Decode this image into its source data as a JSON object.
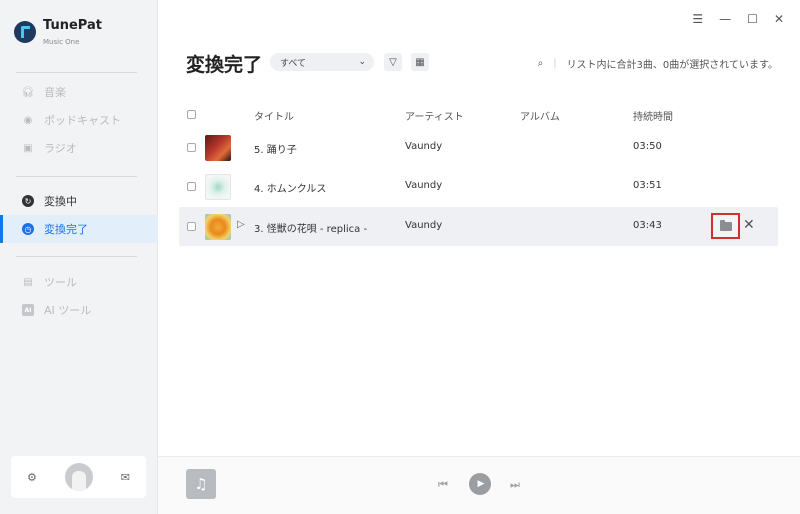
{
  "app": {
    "name": "TunePat",
    "subtitle": "Music One"
  },
  "sidebar": {
    "items": [
      {
        "label": "音楽",
        "icon": "headphones-icon"
      },
      {
        "label": "ポッドキャスト",
        "icon": "podcast-icon"
      },
      {
        "label": "ラジオ",
        "icon": "radio-icon"
      },
      {
        "label": "変換中",
        "icon": "converting-icon"
      },
      {
        "label": "変換完了",
        "icon": "clock-icon"
      },
      {
        "label": "ツール",
        "icon": "toolbox-icon"
      },
      {
        "label": "AI ツール",
        "icon": "ai-icon"
      }
    ],
    "ai_glyph": "AI"
  },
  "window_controls": {
    "menu": "☰",
    "minimize": "—",
    "maximize": "☐",
    "close": "✕"
  },
  "main": {
    "title": "変換完了",
    "filter": {
      "value": "すべて",
      "arrow": "⌄"
    },
    "status_text": "リスト内に合計3曲、0曲が選択されています。",
    "search_glyph": "⌕",
    "separator": "|",
    "columns": {
      "title": "タイトル",
      "artist": "アーティスト",
      "album": "アルバム",
      "duration": "持続時間"
    },
    "tracks": [
      {
        "title": "5. 踊り子",
        "artist": "Vaundy",
        "album": "",
        "duration": "03:50"
      },
      {
        "title": "4. ホムンクルス",
        "artist": "Vaundy",
        "album": "",
        "duration": "03:51"
      },
      {
        "title": "3. 怪獣の花唄 - replica -",
        "artist": "Vaundy",
        "album": "",
        "duration": "03:43"
      }
    ]
  },
  "player": {
    "prev": "⏮",
    "play": "▶",
    "next": "⏭",
    "note": "♫"
  },
  "colors": {
    "accent": "#1a73e8",
    "highlight_border": "#d32f2f",
    "sidebar_bg": "#f2f3f5"
  }
}
